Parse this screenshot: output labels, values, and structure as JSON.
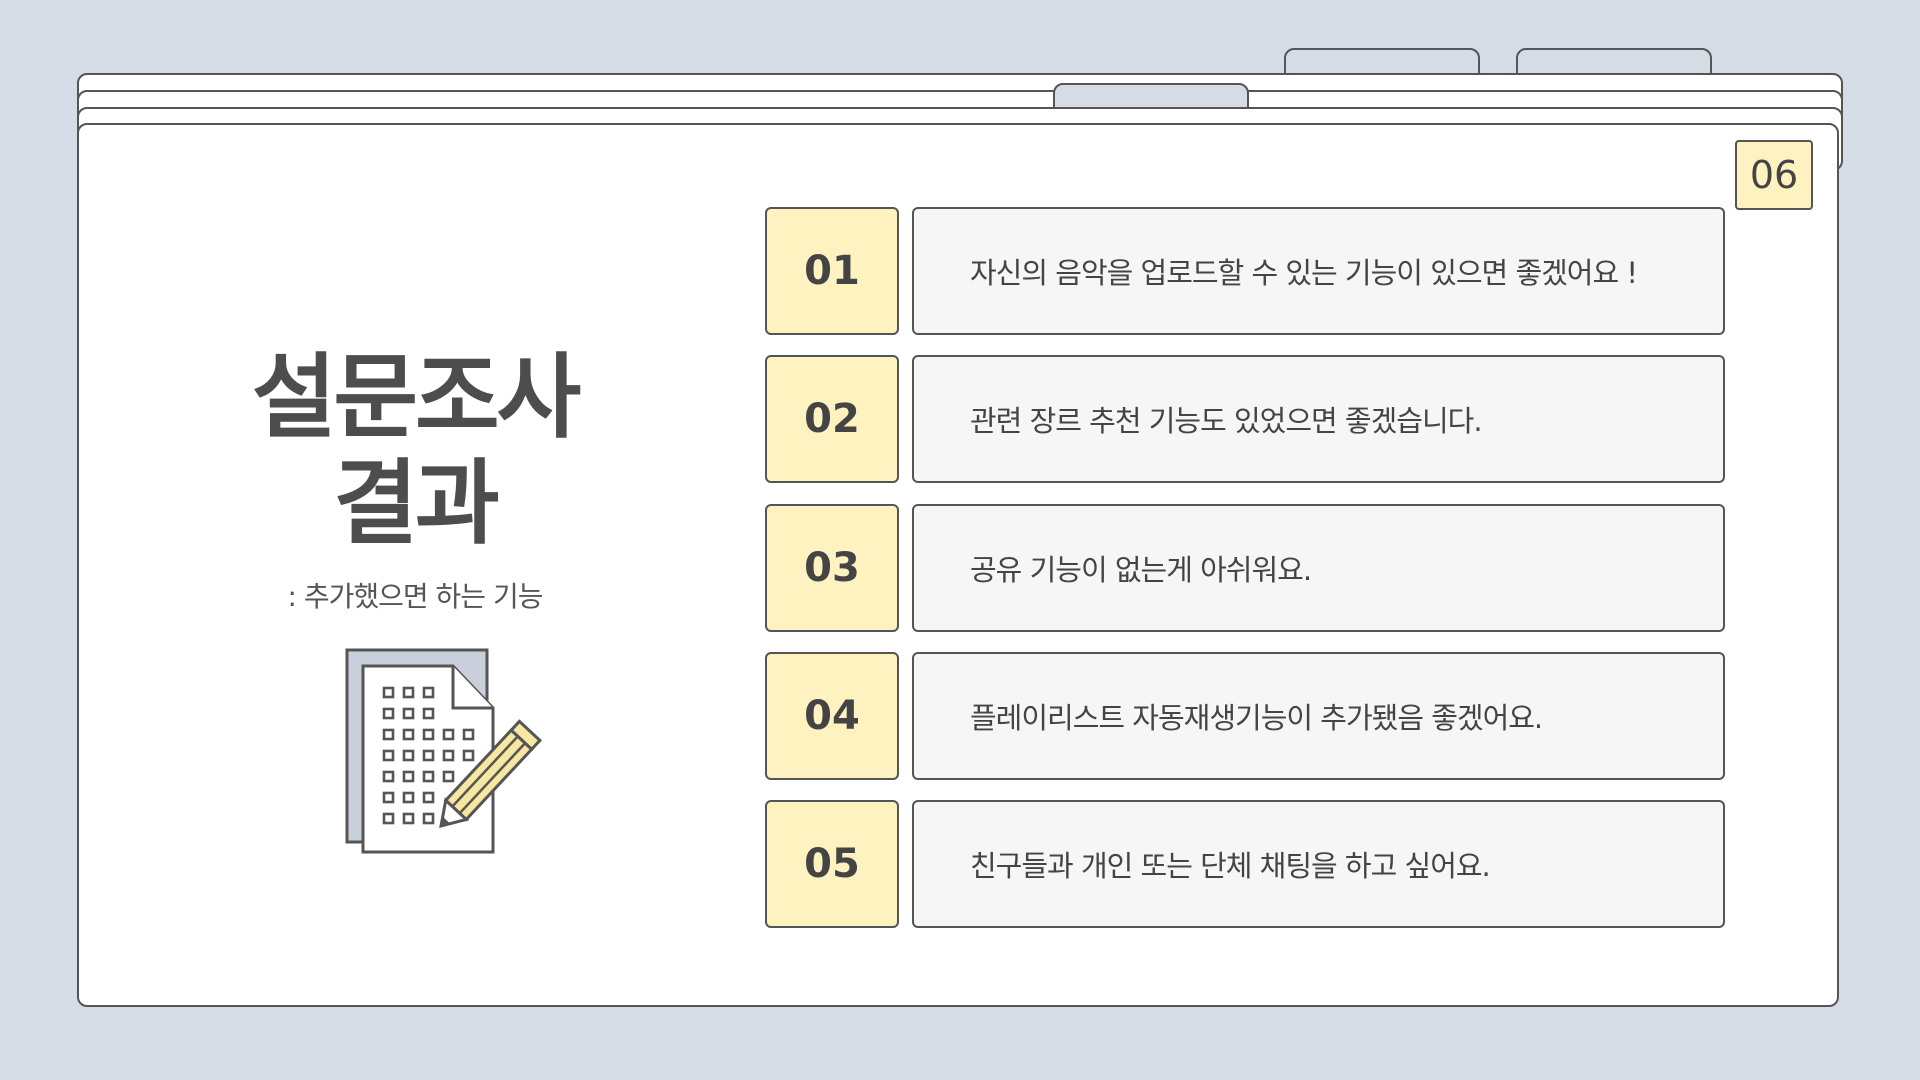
{
  "page_number": "06",
  "title_line1": "설문조사",
  "title_line2": "결과",
  "subtitle": ": 추가했으면 하는 기능",
  "illustration_icon": "document-with-pencil-icon",
  "colors": {
    "background": "#d5dce6",
    "accent_yellow": "#fdf2c0",
    "card": "#ffffff",
    "text_box": "#f6f6f6",
    "outline": "#555555"
  },
  "items": [
    {
      "num": "01",
      "text": "자신의 음악을 업로드할 수 있는 기능이 있으면 좋겠어요 !"
    },
    {
      "num": "02",
      "text": "관련 장르 추천 기능도 있었으면 좋겠습니다."
    },
    {
      "num": "03",
      "text": "공유 기능이 없는게 아쉬워요."
    },
    {
      "num": "04",
      "text": "플레이리스트 자동재생기능이 추가됐음 좋겠어요."
    },
    {
      "num": "05",
      "text": "친구들과 개인 또는 단체 채팅을 하고 싶어요."
    }
  ]
}
